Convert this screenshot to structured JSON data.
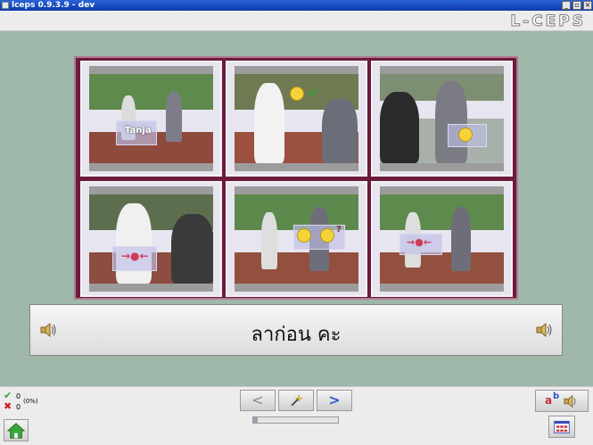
{
  "window": {
    "title": "lceps 0.9.3.9 - dev"
  },
  "header": {
    "logo": "L-CEPS"
  },
  "tiles": [
    {
      "overlay_text": "Tanja"
    },
    {
      "overlay_text": ""
    },
    {
      "overlay_text": ""
    },
    {
      "overlay_text": ""
    },
    {
      "overlay_text": ""
    },
    {
      "overlay_text": ""
    }
  ],
  "sentence": {
    "text": "ลาก่อน คะ"
  },
  "score": {
    "correct": "0",
    "correct_percent": "(0%)",
    "wrong": "0"
  },
  "nav": {
    "prev": "<",
    "hint": "",
    "next": ">"
  },
  "progress": {
    "fraction": 0.05
  },
  "colors": {
    "frame": "#6b1c3a",
    "background": "#9fb8a9",
    "next_arrow": "#2a5fd0"
  }
}
